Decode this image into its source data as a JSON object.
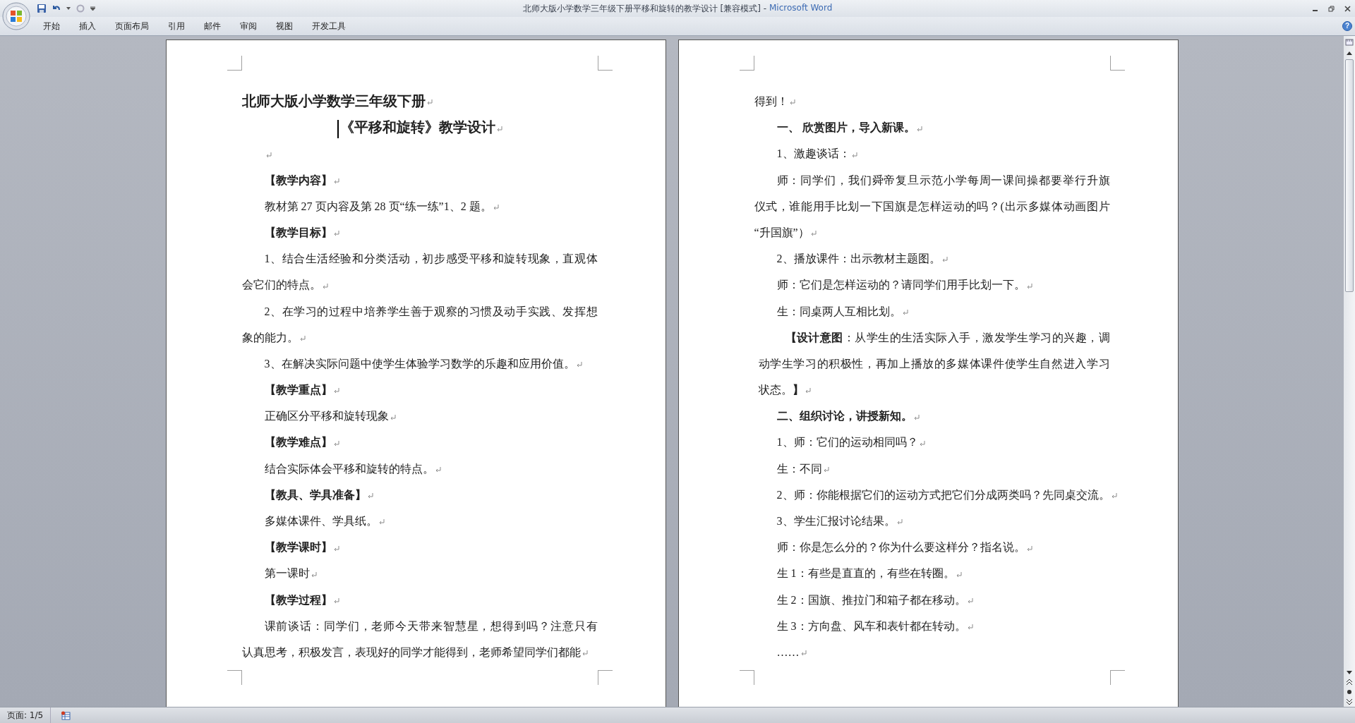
{
  "window": {
    "title": "北师大版小学数学三年级下册平移和旋转的教学设计 [兼容模式] -",
    "app_name": "Microsoft Word"
  },
  "ribbon_tabs": [
    "开始",
    "插入",
    "页面布局",
    "引用",
    "邮件",
    "审阅",
    "视图",
    "开发工具"
  ],
  "help_button": "?",
  "pages": [
    {
      "paragraphs": [
        {
          "kind": "title",
          "lines": [
            "北师大版小学数学三年级下册"
          ]
        },
        {
          "kind": "subtitle",
          "cursor": true,
          "lines": [
            "《平移和旋转》教学设计"
          ]
        },
        {
          "kind": "empty"
        },
        {
          "kind": "heading",
          "lines": [
            "【教学内容】"
          ]
        },
        {
          "kind": "body",
          "lines": [
            "教材第 27 页内容及第 28 页“练一练”1、2 题。"
          ]
        },
        {
          "kind": "heading",
          "lines": [
            "【教学目标】"
          ]
        },
        {
          "kind": "body",
          "lines": [
            "1、结合生活经验和分类活动，初步感受平移和旋转现象，直观体",
            "会它们的特点。"
          ]
        },
        {
          "kind": "body",
          "lines": [
            "2、在学习的过程中培养学生善于观察的习惯及动手实践、发挥想",
            "象的能力。"
          ]
        },
        {
          "kind": "body",
          "lines": [
            "3、在解决实际问题中使学生体验学习数学的乐趣和应用价值。"
          ]
        },
        {
          "kind": "heading",
          "lines": [
            "【教学重点】"
          ]
        },
        {
          "kind": "body",
          "lines": [
            "正确区分平移和旋转现象"
          ]
        },
        {
          "kind": "heading",
          "lines": [
            "【教学难点】"
          ]
        },
        {
          "kind": "body",
          "lines": [
            "结合实际体会平移和旋转的特点。"
          ]
        },
        {
          "kind": "heading",
          "lines": [
            "【教具、学具准备】"
          ]
        },
        {
          "kind": "body",
          "lines": [
            "多媒体课件、学具纸。"
          ]
        },
        {
          "kind": "heading",
          "lines": [
            "【教学课时】"
          ]
        },
        {
          "kind": "body",
          "lines": [
            "第一课时"
          ]
        },
        {
          "kind": "heading",
          "lines": [
            "【教学过程】"
          ]
        },
        {
          "kind": "open",
          "lines": [
            "课前谈话：同学们，老师今天带来智慧星，想得到吗？注意只有",
            "认真思考，积极发言，表现好的同学才能得到，老师希望同学们都能"
          ]
        }
      ]
    },
    {
      "paragraphs": [
        {
          "kind": "continuation",
          "lines": [
            "得到！"
          ]
        },
        {
          "kind": "heading",
          "lines": [
            "一、 欣赏图片，导入新课。"
          ]
        },
        {
          "kind": "body",
          "lines": [
            "1、激趣谈话："
          ]
        },
        {
          "kind": "body",
          "lines": [
            "师：同学们，我们舜帝复旦示范小学每周一课间操都要举行升旗",
            "仪式，谁能用手比划一下国旗是怎样运动的吗？(出示多媒体动画图片",
            "“升国旗”）"
          ]
        },
        {
          "kind": "body",
          "lines": [
            "2、播放课件：出示教材主题图。"
          ]
        },
        {
          "kind": "body",
          "lines": [
            "师：它们是怎样运动的？请同学们用手比划一下。"
          ]
        },
        {
          "kind": "body",
          "lines": [
            "生：同桌两人互相比划。"
          ]
        },
        {
          "kind": "note",
          "lines": [
            "**【设计意图**：从学生的生活实际入手，激发学生学习的兴趣，调",
            "动学生学习的积极性，再加上播放的多媒体课件使学生自然进入学习",
            "状态。**】**"
          ]
        },
        {
          "kind": "heading",
          "lines": [
            "二、组织讨论，讲授新知。"
          ]
        },
        {
          "kind": "body",
          "lines": [
            "1、师：它们的运动相同吗？"
          ]
        },
        {
          "kind": "body",
          "lines": [
            "生：不同"
          ]
        },
        {
          "kind": "body",
          "lines": [
            "2、师：你能根据它们的运动方式把它们分成两类吗？先同桌交流。"
          ]
        },
        {
          "kind": "body",
          "lines": [
            "3、学生汇报讨论结果。"
          ]
        },
        {
          "kind": "body",
          "lines": [
            "师：你是怎么分的？你为什么要这样分？指名说。"
          ]
        },
        {
          "kind": "body",
          "lines": [
            "生 1：有些是直直的，有些在转圈。"
          ]
        },
        {
          "kind": "body",
          "lines": [
            "生 2：国旗、推拉门和箱子都在移动。"
          ]
        },
        {
          "kind": "body",
          "lines": [
            "生 3：方向盘、风车和表针都在转动。"
          ]
        },
        {
          "kind": "body",
          "lines": [
            "……"
          ]
        }
      ]
    }
  ],
  "status_bar": {
    "page": "页面: 1/5"
  }
}
